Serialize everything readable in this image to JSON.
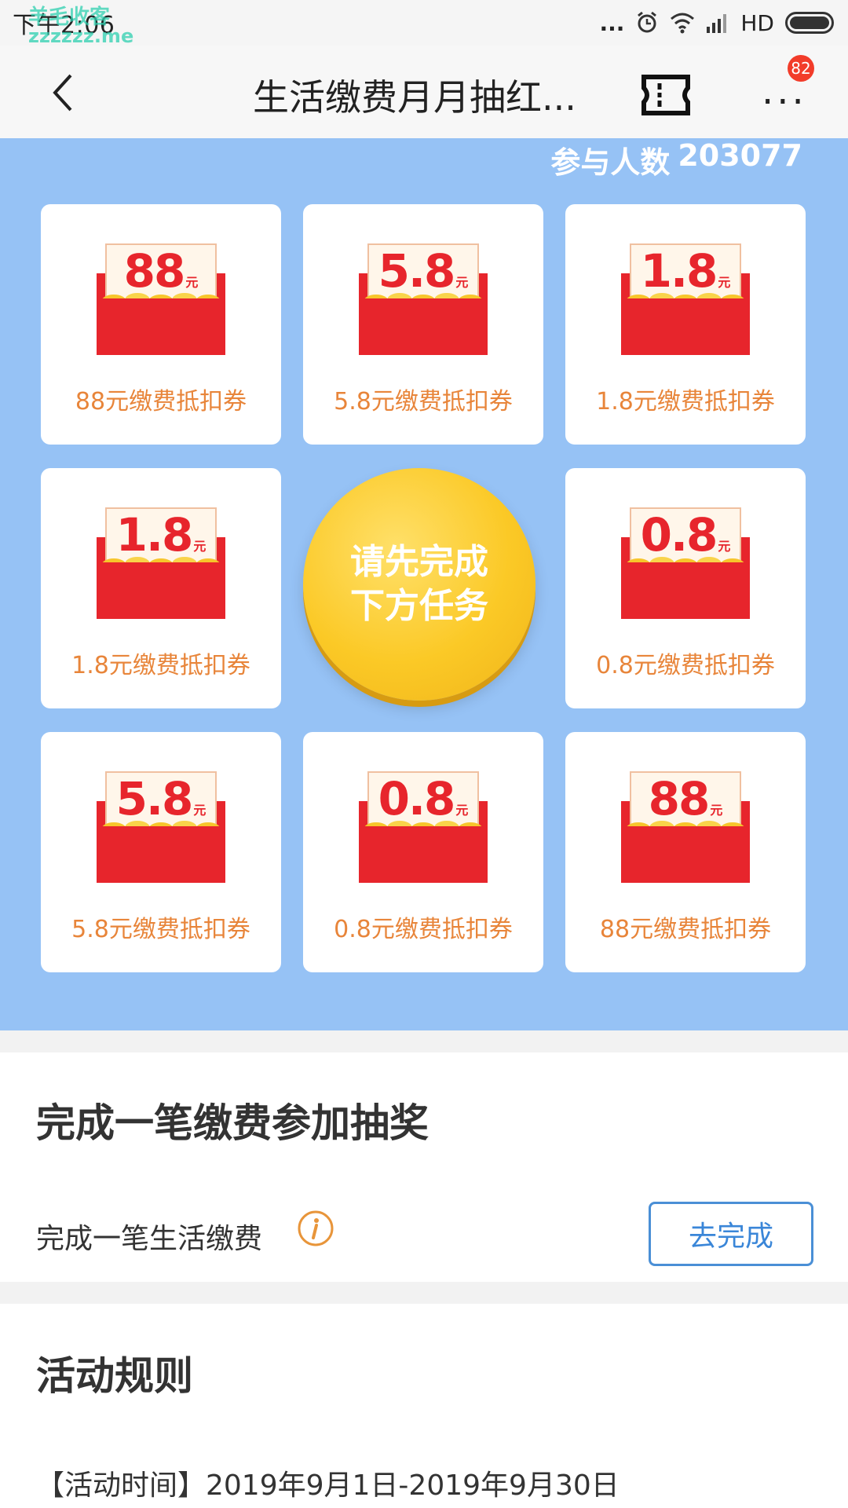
{
  "status_bar": {
    "time": "下午2:06",
    "watermark_top": "羊毛收客",
    "watermark_bottom": "zzzzzz.me",
    "dots": "...",
    "network": "HD"
  },
  "title_bar": {
    "title": "生活缴费月月抽红...",
    "badge_count": "82",
    "more": "..."
  },
  "lottery": {
    "participants_label": "参与人数",
    "participants_count": "203077",
    "draw_button_text": "请先完成下方任务",
    "currency_small": "元",
    "cards": [
      {
        "value": "88",
        "label": "88元缴费抵扣券"
      },
      {
        "value": "5.8",
        "label": "5.8元缴费抵扣券"
      },
      {
        "value": "1.8",
        "label": "1.8元缴费抵扣券"
      },
      {
        "value": "1.8",
        "label": "1.8元缴费抵扣券"
      },
      {
        "value": "0.8",
        "label": "0.8元缴费抵扣券"
      },
      {
        "value": "5.8",
        "label": "5.8元缴费抵扣券"
      },
      {
        "value": "0.8",
        "label": "0.8元缴费抵扣券"
      },
      {
        "value": "88",
        "label": "88元缴费抵扣券"
      }
    ]
  },
  "task": {
    "heading": "完成一笔缴费参加抽奖",
    "item_text": "完成一笔生活缴费",
    "button_label": "去完成"
  },
  "rules": {
    "heading": "活动规则",
    "time_line": "【活动时间】2019年9月1日-2019年9月30日"
  },
  "colors": {
    "lottery_bg": "#96c2f5",
    "envelope_red": "#e7252c",
    "label_orange": "#e8853a",
    "button_gold": "#fbc926",
    "link_blue": "#3a86d8"
  }
}
